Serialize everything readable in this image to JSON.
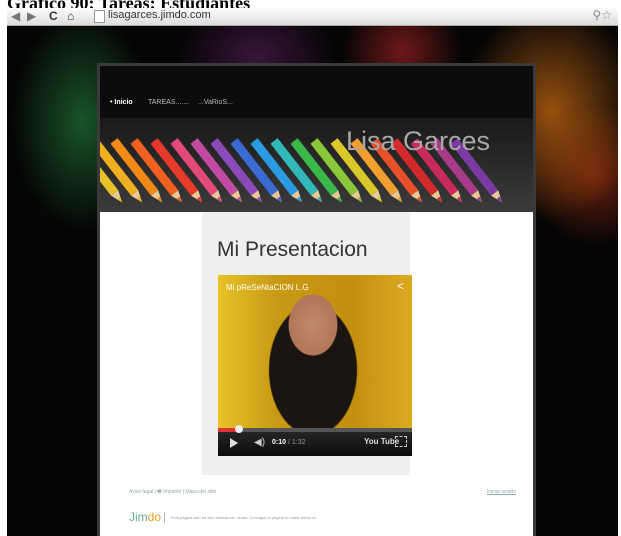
{
  "caption": "Gráfico 90: Tareas: Estudiantes",
  "browser": {
    "url": "lisagarces.jimdo.com",
    "back_icon": "back-arrow-icon",
    "forward_icon": "forward-arrow-icon",
    "reload_icon": "reload-icon",
    "home_icon": "home-icon"
  },
  "site": {
    "nav": [
      "• Inicio",
      "TAREAS.......",
      "...VaRioS..."
    ],
    "title": "Lisa Garces",
    "pencil_colors": [
      "#e8c02a",
      "#f0b020",
      "#f28a18",
      "#f06020",
      "#e83a2a",
      "#e24a7a",
      "#c24aa2",
      "#8a4aba",
      "#3a6ad2",
      "#2a9ae2",
      "#32b8b8",
      "#3ab84a",
      "#8ac83a",
      "#d8c82a",
      "#f0a030",
      "#e8502a",
      "#d22a2a",
      "#c82a5a",
      "#a83a8a",
      "#7a3aa2"
    ],
    "heading": "Mi Presentacion",
    "video": {
      "title": "Mi pReSeNtaCION L.G",
      "time": "0:10",
      "duration": "/ 1:32",
      "brand": "You Tube",
      "progress_fraction": 0.11
    },
    "footer": {
      "links": "Aviso legal | 🖶 Imprimir | Mapa del sitio",
      "login": "Iniciar sesión",
      "brand_a": "Jim",
      "brand_b": "do",
      "note": "Esta página web ha sido creada con Jimdo. Consigue tu página en www.Jimdo.es"
    }
  }
}
